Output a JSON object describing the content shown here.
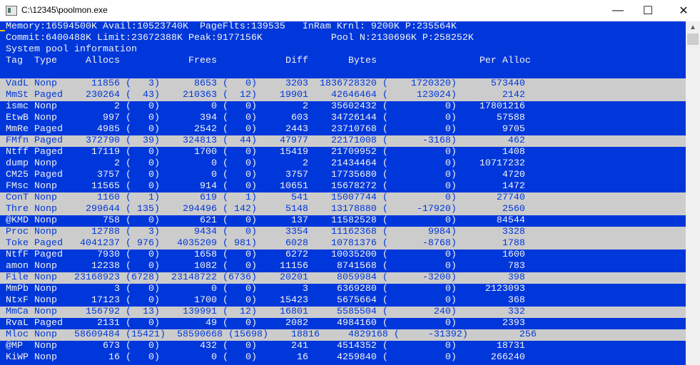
{
  "window": {
    "title": "C:\\12345\\poolmon.exe",
    "minimize": "—",
    "maximize": "☐",
    "close": "✕"
  },
  "summary": {
    "line1": "Memory:16594500K Avail:10523740K  PageFlts:139535   InRam Krnl: 9200K P:235564K",
    "line2": "Commit:6400488K Limit:23672388K Peak:9177156K            Pool N:2130696K P:258252K",
    "line3": "System pool information"
  },
  "columns": [
    "Tag",
    "Type",
    "Allocs",
    "Frees",
    "Diff",
    "Bytes",
    "Per Alloc"
  ],
  "rows": [
    {
      "tag": "VadL",
      "type": "Nonp",
      "allocs": "11856",
      "allocs_d": "3",
      "frees": "8653",
      "frees_d": "0",
      "diff": "3203",
      "bytes": "1836728320",
      "bytes_d": "1720320",
      "per": "573440",
      "hl": true
    },
    {
      "tag": "MmSt",
      "type": "Paged",
      "allocs": "230264",
      "allocs_d": "43",
      "frees": "210363",
      "frees_d": "12",
      "diff": "19901",
      "bytes": "42646464",
      "bytes_d": "123024",
      "per": "2142",
      "hl": true
    },
    {
      "tag": "ismc",
      "type": "Nonp",
      "allocs": "2",
      "allocs_d": "0",
      "frees": "0",
      "frees_d": "0",
      "diff": "2",
      "bytes": "35602432",
      "bytes_d": "0",
      "per": "17801216",
      "hl": false
    },
    {
      "tag": "EtwB",
      "type": "Nonp",
      "allocs": "997",
      "allocs_d": "0",
      "frees": "394",
      "frees_d": "0",
      "diff": "603",
      "bytes": "34726144",
      "bytes_d": "0",
      "per": "57588",
      "hl": false
    },
    {
      "tag": "MmRe",
      "type": "Paged",
      "allocs": "4985",
      "allocs_d": "0",
      "frees": "2542",
      "frees_d": "0",
      "diff": "2443",
      "bytes": "23710768",
      "bytes_d": "0",
      "per": "9705",
      "hl": false
    },
    {
      "tag": "FMfn",
      "type": "Paged",
      "allocs": "372790",
      "allocs_d": "39",
      "frees": "324813",
      "frees_d": "44",
      "diff": "47977",
      "bytes": "22171008",
      "bytes_d": "-3168",
      "per": "462",
      "hl": true
    },
    {
      "tag": "Ntff",
      "type": "Paged",
      "allocs": "17119",
      "allocs_d": "0",
      "frees": "1700",
      "frees_d": "0",
      "diff": "15419",
      "bytes": "21709952",
      "bytes_d": "0",
      "per": "1408",
      "hl": false
    },
    {
      "tag": "dump",
      "type": "Nonp",
      "allocs": "2",
      "allocs_d": "0",
      "frees": "0",
      "frees_d": "0",
      "diff": "2",
      "bytes": "21434464",
      "bytes_d": "0",
      "per": "10717232",
      "hl": false
    },
    {
      "tag": "CM25",
      "type": "Paged",
      "allocs": "3757",
      "allocs_d": "0",
      "frees": "0",
      "frees_d": "0",
      "diff": "3757",
      "bytes": "17735680",
      "bytes_d": "0",
      "per": "4720",
      "hl": false
    },
    {
      "tag": "FMsc",
      "type": "Nonp",
      "allocs": "11565",
      "allocs_d": "0",
      "frees": "914",
      "frees_d": "0",
      "diff": "10651",
      "bytes": "15678272",
      "bytes_d": "0",
      "per": "1472",
      "hl": false
    },
    {
      "tag": "ConT",
      "type": "Nonp",
      "allocs": "1160",
      "allocs_d": "1",
      "frees": "619",
      "frees_d": "1",
      "diff": "541",
      "bytes": "15007744",
      "bytes_d": "0",
      "per": "27740",
      "hl": true
    },
    {
      "tag": "Thre",
      "type": "Nonp",
      "allocs": "299644",
      "allocs_d": "135",
      "frees": "294496",
      "frees_d": "142",
      "diff": "5148",
      "bytes": "13178880",
      "bytes_d": "-17920",
      "per": "2560",
      "hl": true
    },
    {
      "tag": "@KMD",
      "type": "Nonp",
      "allocs": "758",
      "allocs_d": "0",
      "frees": "621",
      "frees_d": "0",
      "diff": "137",
      "bytes": "11582528",
      "bytes_d": "0",
      "per": "84544",
      "hl": false
    },
    {
      "tag": "Proc",
      "type": "Nonp",
      "allocs": "12788",
      "allocs_d": "3",
      "frees": "9434",
      "frees_d": "0",
      "diff": "3354",
      "bytes": "11162368",
      "bytes_d": "9984",
      "per": "3328",
      "hl": true
    },
    {
      "tag": "Toke",
      "type": "Paged",
      "allocs": "4041237",
      "allocs_d": "976",
      "frees": "4035209",
      "frees_d": "981",
      "diff": "6028",
      "bytes": "10781376",
      "bytes_d": "-8768",
      "per": "1788",
      "hl": true
    },
    {
      "tag": "NtfF",
      "type": "Paged",
      "allocs": "7930",
      "allocs_d": "0",
      "frees": "1658",
      "frees_d": "0",
      "diff": "6272",
      "bytes": "10035200",
      "bytes_d": "0",
      "per": "1600",
      "hl": false
    },
    {
      "tag": "amon",
      "type": "Nonp",
      "allocs": "12238",
      "allocs_d": "0",
      "frees": "1082",
      "frees_d": "0",
      "diff": "11156",
      "bytes": "8741568",
      "bytes_d": "0",
      "per": "783",
      "hl": false
    },
    {
      "tag": "File",
      "type": "Nonp",
      "allocs": "23168923",
      "allocs_d": "6728",
      "frees": "23148722",
      "frees_d": "6736",
      "diff": "20201",
      "bytes": "8059984",
      "bytes_d": "-3200",
      "per": "398",
      "hl": true
    },
    {
      "tag": "MmPb",
      "type": "Nonp",
      "allocs": "3",
      "allocs_d": "0",
      "frees": "0",
      "frees_d": "0",
      "diff": "3",
      "bytes": "6369280",
      "bytes_d": "0",
      "per": "2123093",
      "hl": false
    },
    {
      "tag": "NtxF",
      "type": "Nonp",
      "allocs": "17123",
      "allocs_d": "0",
      "frees": "1700",
      "frees_d": "0",
      "diff": "15423",
      "bytes": "5675664",
      "bytes_d": "0",
      "per": "368",
      "hl": false
    },
    {
      "tag": "MmCa",
      "type": "Nonp",
      "allocs": "156792",
      "allocs_d": "13",
      "frees": "139991",
      "frees_d": "12",
      "diff": "16801",
      "bytes": "5585504",
      "bytes_d": "240",
      "per": "332",
      "hl": true
    },
    {
      "tag": "RvaL",
      "type": "Paged",
      "allocs": "2131",
      "allocs_d": "0",
      "frees": "49",
      "frees_d": "0",
      "diff": "2082",
      "bytes": "4984160",
      "bytes_d": "0",
      "per": "2393",
      "hl": false
    },
    {
      "tag": "Mloc",
      "type": "Nonp",
      "allocs": "58609484",
      "allocs_d": "15421",
      "frees": "58590668",
      "frees_d": "15698",
      "diff": "18816",
      "bytes": "4829168",
      "bytes_d": "-31392",
      "per": "256",
      "hl": true
    },
    {
      "tag": "@MP",
      "type": "Nonp",
      "allocs": "673",
      "allocs_d": "0",
      "frees": "432",
      "frees_d": "0",
      "diff": "241",
      "bytes": "4514352",
      "bytes_d": "0",
      "per": "18731",
      "hl": false
    },
    {
      "tag": "KiWP",
      "type": "Nonp",
      "allocs": "16",
      "allocs_d": "0",
      "frees": "0",
      "frees_d": "0",
      "diff": "16",
      "bytes": "4259840",
      "bytes_d": "0",
      "per": "266240",
      "hl": false
    }
  ],
  "colors": {
    "console_bg": "#0037da",
    "console_fg": "#f2f2f2",
    "highlight_bg": "#cccccc",
    "highlight_fg": "#0037da"
  }
}
